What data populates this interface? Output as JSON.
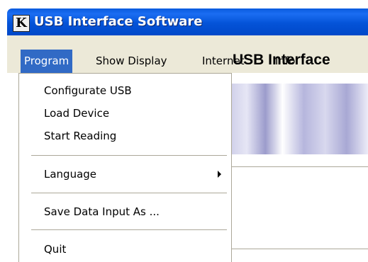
{
  "window": {
    "title": "USB Interface Software",
    "icon_letter": "K"
  },
  "menubar": {
    "items": [
      {
        "label": "Program",
        "active": true
      },
      {
        "label": "Show Display",
        "active": false
      },
      {
        "label": "Internet",
        "active": false
      },
      {
        "label": "Info",
        "active": false
      }
    ]
  },
  "client": {
    "banner_text": "USB Interface"
  },
  "dropdown": {
    "items": [
      {
        "label": "Configurate USB"
      },
      {
        "label": "Load Device"
      },
      {
        "label": "Start Reading"
      },
      {
        "label": "Language",
        "has_submenu": true
      },
      {
        "label": "Save Data Input As ..."
      },
      {
        "label": "Quit"
      }
    ]
  },
  "colors": {
    "titlebar": "#0453d8",
    "menu_highlight": "#316ac5",
    "menubar_bg": "#ece9d8"
  }
}
